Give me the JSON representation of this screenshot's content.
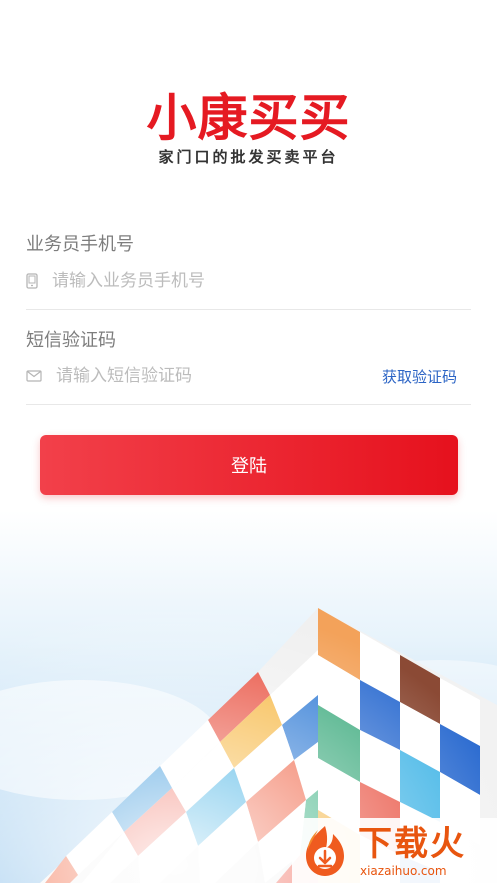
{
  "brand": {
    "title": "小康买买",
    "subtitle": "家门口的批发买卖平台"
  },
  "phone_field": {
    "label": "业务员手机号",
    "placeholder": "请输入业务员手机号",
    "icon": "phone-icon"
  },
  "sms_field": {
    "label": "短信验证码",
    "placeholder": "请输入短信验证码",
    "icon": "mail-icon",
    "get_code_label": "获取验证码"
  },
  "login_button": {
    "label": "登陆"
  },
  "watermark": {
    "brand": "下载火",
    "domain": "xiazaihuo.com"
  },
  "colors": {
    "brand_red": "#e51a22",
    "link_blue": "#2b64c5",
    "watermark_orange": "#e8550f"
  }
}
